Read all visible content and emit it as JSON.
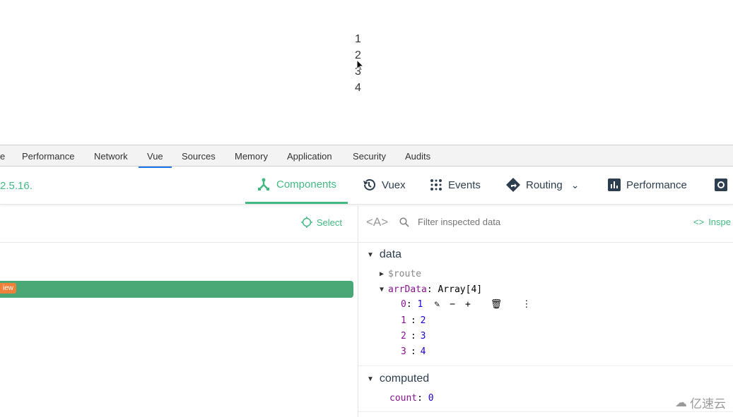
{
  "page": {
    "list": [
      "1",
      "2",
      "3",
      "4"
    ]
  },
  "devtools_tabs": [
    "e",
    "Performance",
    "Network",
    "Vue",
    "Sources",
    "Memory",
    "Application",
    "Security",
    "Audits"
  ],
  "devtools_active": "Vue",
  "vue": {
    "version": "2.5.16.",
    "tabs": [
      {
        "label": "Components",
        "icon": "components-icon"
      },
      {
        "label": "Vuex",
        "icon": "history-icon"
      },
      {
        "label": "Events",
        "icon": "events-icon"
      },
      {
        "label": "Routing",
        "icon": "routing-icon"
      },
      {
        "label": "Performance",
        "icon": "chart-icon"
      }
    ],
    "select_label": "Select",
    "component_tag": "iew",
    "filter_placeholder": "Filter inspected data",
    "inspect_label": "Inspe",
    "format_toggle": "<A>"
  },
  "inspector": {
    "data_label": "data",
    "route_key": "$route",
    "arr_key": "arrData",
    "arr_type": "Array[4]",
    "items": [
      {
        "k": "0",
        "v": "1"
      },
      {
        "k": "1",
        "v": "2"
      },
      {
        "k": "2",
        "v": "3"
      },
      {
        "k": "3",
        "v": "4"
      }
    ],
    "computed_label": "computed",
    "count_key": "count",
    "count_value": "0"
  },
  "watermark": "亿速云",
  "colors": {
    "accent": "#42b983",
    "selected_row": "#4aa876",
    "tag": "#f0813a"
  }
}
